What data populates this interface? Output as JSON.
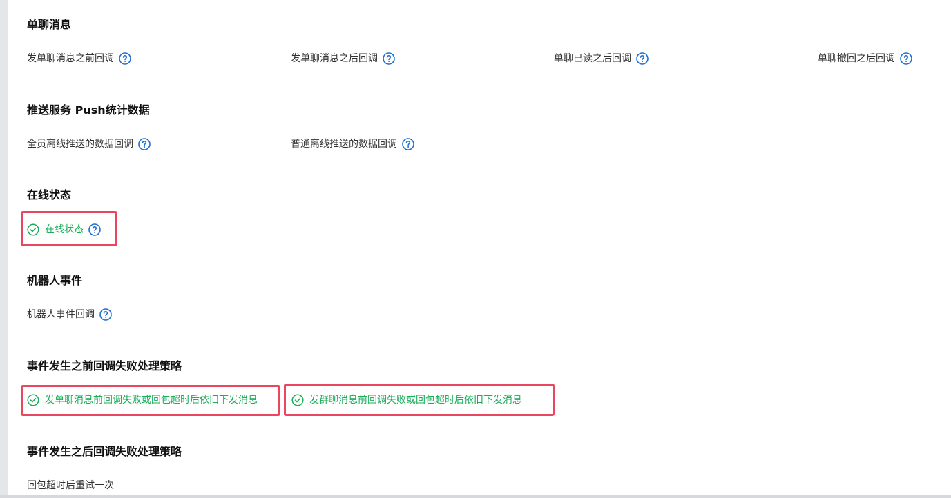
{
  "colors": {
    "help_icon": "#1d6fd6",
    "enabled_text": "#1aad5a",
    "highlight_border": "#e8475f"
  },
  "sections": [
    {
      "title": "单聊消息",
      "items": [
        {
          "label": "发单聊消息之前回调",
          "enabled": false,
          "icon": "help-circle-icon"
        },
        {
          "label": "发单聊消息之后回调",
          "enabled": false,
          "icon": "help-circle-icon"
        },
        {
          "label": "单聊已读之后回调",
          "enabled": false,
          "icon": "help-circle-icon"
        },
        {
          "label": "单聊撤回之后回调",
          "enabled": false,
          "icon": "help-circle-icon"
        }
      ]
    },
    {
      "title": "推送服务 Push统计数据",
      "items": [
        {
          "label": "全员离线推送的数据回调",
          "enabled": false,
          "icon": "help-circle-icon"
        },
        {
          "label": "普通离线推送的数据回调",
          "enabled": false,
          "icon": "help-circle-icon"
        }
      ]
    },
    {
      "title": "在线状态",
      "items": [
        {
          "label": "在线状态",
          "enabled": true,
          "icon": "help-circle-icon"
        }
      ]
    },
    {
      "title": "机器人事件",
      "items": [
        {
          "label": "机器人事件回调",
          "enabled": false,
          "icon": "help-circle-icon"
        }
      ]
    },
    {
      "title": "事件发生之前回调失败处理策略",
      "items": [
        {
          "label": "发单聊消息前回调失败或回包超时后依旧下发消息",
          "enabled": true
        },
        {
          "label": "发群聊消息前回调失败或回包超时后依旧下发消息",
          "enabled": true
        }
      ]
    },
    {
      "title": "事件发生之后回调失败处理策略",
      "items": [
        {
          "label": "回包超时后重试一次",
          "enabled": false
        }
      ]
    }
  ]
}
